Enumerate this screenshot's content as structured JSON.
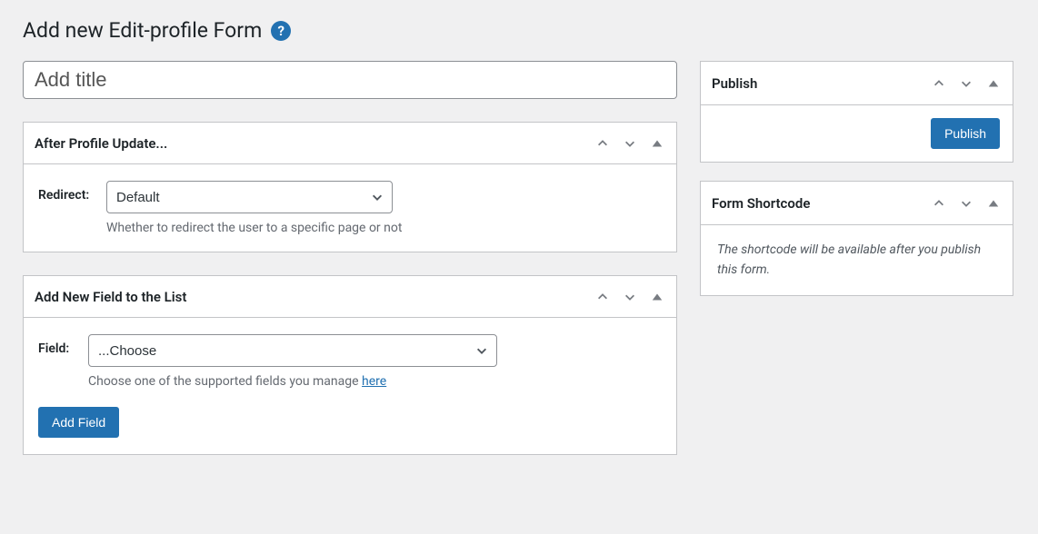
{
  "header": {
    "title": "Add new Edit-profile Form",
    "help_icon": "?"
  },
  "title_input": {
    "placeholder": "Add title",
    "value": ""
  },
  "panels": {
    "after_update": {
      "title": "After Profile Update...",
      "redirect_label": "Redirect:",
      "redirect_value": "Default",
      "redirect_help": "Whether to redirect the user to a specific page or not"
    },
    "add_field": {
      "title": "Add New Field to the List",
      "field_label": "Field:",
      "field_value": "...Choose",
      "field_help_prefix": "Choose one of the supported fields you manage ",
      "field_help_link": "here",
      "add_button": "Add Field"
    }
  },
  "sidebar": {
    "publish": {
      "title": "Publish",
      "button": "Publish"
    },
    "shortcode": {
      "title": "Form Shortcode",
      "message": "The shortcode will be available after you publish this form."
    }
  }
}
